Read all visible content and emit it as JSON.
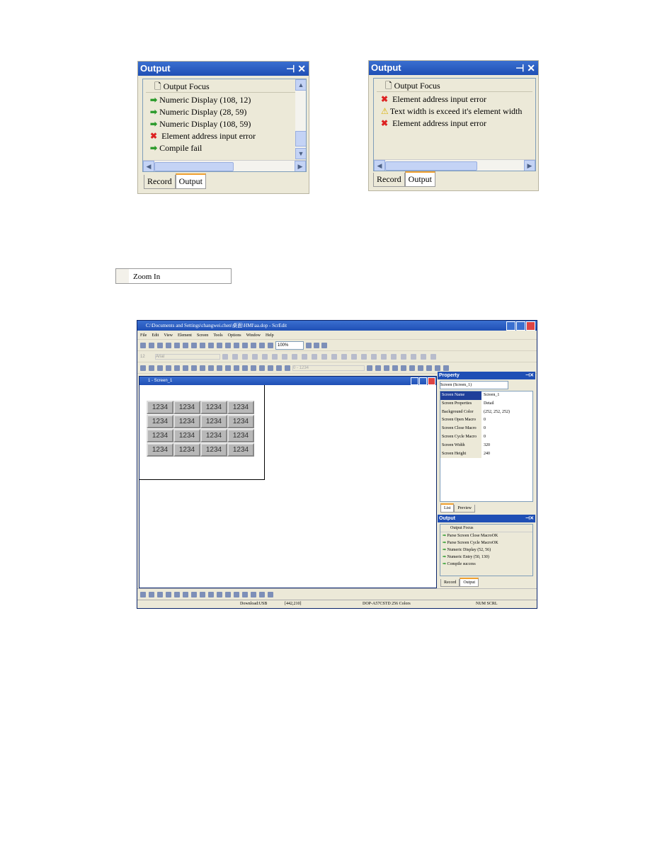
{
  "panel_a": {
    "title": "Output",
    "header": "Output Focus",
    "rows": [
      {
        "icon": "arrow-right-icon",
        "text": "Numeric Display (108, 12)"
      },
      {
        "icon": "arrow-right-icon",
        "text": "Numeric Display (28, 59)"
      },
      {
        "icon": "arrow-right-icon",
        "text": "Numeric Display (108, 59)"
      },
      {
        "icon": "error-x-icon",
        "text": "Element address input error"
      },
      {
        "icon": "arrow-right-icon",
        "text": "Compile fail"
      }
    ],
    "tabs": [
      "Record",
      "Output"
    ],
    "active_tab": "Output"
  },
  "panel_b": {
    "title": "Output",
    "header": "Output Focus",
    "rows": [
      {
        "icon": "error-x-icon",
        "text": "Element address input error"
      },
      {
        "icon": "warning-icon",
        "text": "Text width is exceed it's element width"
      },
      {
        "icon": "error-x-icon",
        "text": "Element address input error"
      }
    ],
    "tabs": [
      "Record",
      "Output"
    ],
    "active_tab": "Output"
  },
  "menu_item": {
    "label": "Zoom In"
  },
  "app": {
    "title": "C:\\Documents and Settings\\changwei.chen\\桌面\\HMI\\aa.dop - ScrEdit",
    "menu": [
      "File",
      "Edit",
      "View",
      "Element",
      "Screen",
      "Tools",
      "Options",
      "Window",
      "Help"
    ],
    "zoom_value": "100%",
    "font_size": "12",
    "font_name": "Arial",
    "value_field": "0 - 1234",
    "screen_title": "1 - Screen_1",
    "cell_text": "1234",
    "property": {
      "title": "Property",
      "selector": "Screen (Screen_1)",
      "rows": [
        {
          "k": "Screen Name",
          "v": "Screen_1"
        },
        {
          "k": "Screen Properties",
          "v": "Detail"
        },
        {
          "k": "Background Color",
          "v": "(252, 252, 252)"
        },
        {
          "k": "Screen Open Macro",
          "v": "0"
        },
        {
          "k": "Screen Close Macro",
          "v": "0"
        },
        {
          "k": "Screen Cycle Macro",
          "v": "0"
        },
        {
          "k": "Screen Width",
          "v": "320"
        },
        {
          "k": "Screen Height",
          "v": "240"
        }
      ],
      "tabs": [
        "List",
        "Preview"
      ]
    },
    "output": {
      "title": "Output",
      "header": "Output Focus",
      "rows": [
        "Parse Screen Close MacroOK",
        "Parse Screen Cycle MacroOK",
        "Numeric Display (52, 56)",
        "Numeric Entry (50, 130)",
        "Compile success"
      ],
      "tabs": [
        "Record",
        "Output"
      ]
    },
    "status": {
      "download": "Download:USB",
      "coords": "[442,210]",
      "model": "DOP-A57CSTD 256 Colors",
      "keys": "NUM  SCRL"
    }
  },
  "colors": {
    "titlebar": "#1f4fb5",
    "ok": "#2a9a2a",
    "error": "#dd2222",
    "warning": "#e8c000"
  }
}
